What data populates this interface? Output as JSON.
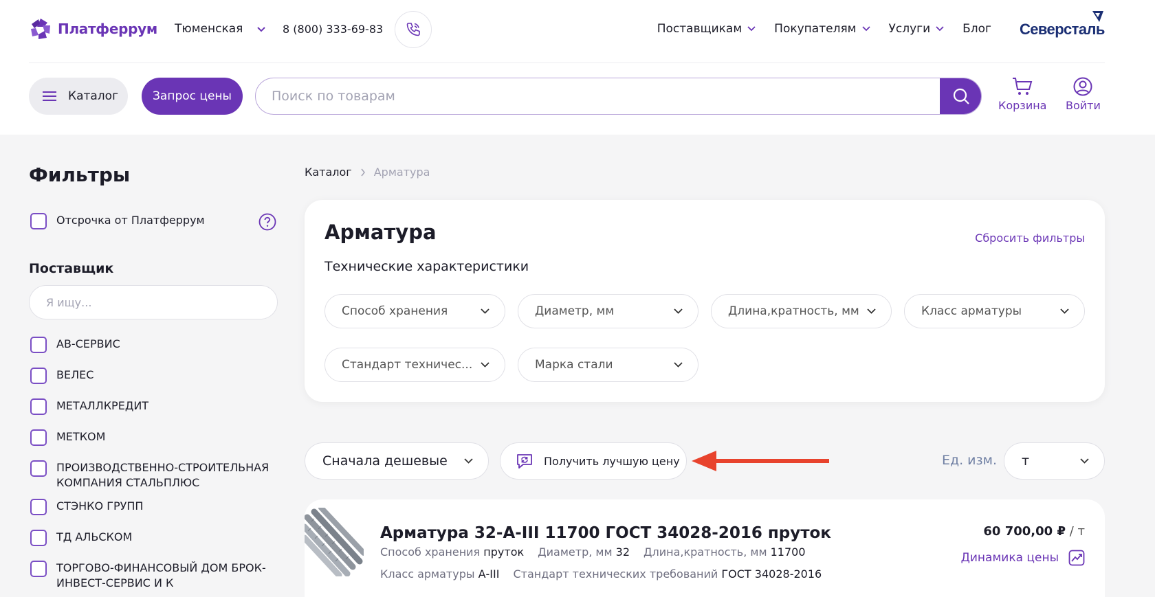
{
  "header": {
    "logo_text": "Платферрум",
    "city": "Тюменская",
    "phone": "8 (800) 333-69-83",
    "nav": [
      "Поставщикам",
      "Покупателям",
      "Услуги",
      "Блог"
    ],
    "partner_brand": "Северсталь",
    "catalog_label": "Каталог",
    "price_request_label": "Запрос цены",
    "search_placeholder": "Поиск по товарам",
    "cart_label": "Корзина",
    "login_label": "Войти"
  },
  "sidebar": {
    "title": "Фильтры",
    "deferral_label": "Отсрочка от Платферрум",
    "supplier_title": "Поставщик",
    "supplier_search_placeholder": "Я ищу...",
    "suppliers": [
      "АВ-СЕРВИС",
      "ВЕЛЕС",
      "МЕТАЛЛКРЕДИТ",
      "МЕТКОМ",
      "ПРОИЗВОДСТВЕННО-СТРОИТЕЛЬНАЯ КОМПАНИЯ СТАЛЬПЛЮС",
      "СТЭНКО ГРУПП",
      "ТД АЛЬСКОМ",
      "ТОРГОВО-ФИНАНСОВЫЙ ДОМ БРОК-ИНВЕСТ-СЕРВИС И К"
    ]
  },
  "breadcrumb": {
    "root": "Каталог",
    "current": "Арматура"
  },
  "filter_card": {
    "title": "Арматура",
    "reset_label": "Сбросить фильтры",
    "subtitle": "Технические характеристики",
    "selects": [
      "Способ хранения",
      "Диаметр, мм",
      "Длина,кратность, мм",
      "Класс арматуры",
      "Стандарт техничес...",
      "Марка стали"
    ]
  },
  "sort": {
    "value": "Сначала дешевые",
    "best_price_label": "Получить лучшую цену",
    "unit_label": "Ед. изм.",
    "unit_value": "т"
  },
  "product": {
    "name": "Арматура 32-А-III 11700 ГОСТ 34028-2016 пруток",
    "attrs_row1": [
      {
        "k": "Способ хранения",
        "v": "пруток"
      },
      {
        "k": "Диаметр, мм",
        "v": "32"
      },
      {
        "k": "Длина,кратность, мм",
        "v": "11700"
      }
    ],
    "attrs_row2": [
      {
        "k": "Класс арматуры",
        "v": "А-III"
      },
      {
        "k": "Стандарт технических требований",
        "v": "ГОСТ 34028-2016"
      }
    ],
    "price": "60 700,00 ₽",
    "price_unit": "/ т",
    "dynamics_label": "Динамика цены"
  },
  "colors": {
    "accent": "#6a35b5",
    "annotation_arrow": "#e8432d",
    "brand2": "#1b2f74"
  }
}
